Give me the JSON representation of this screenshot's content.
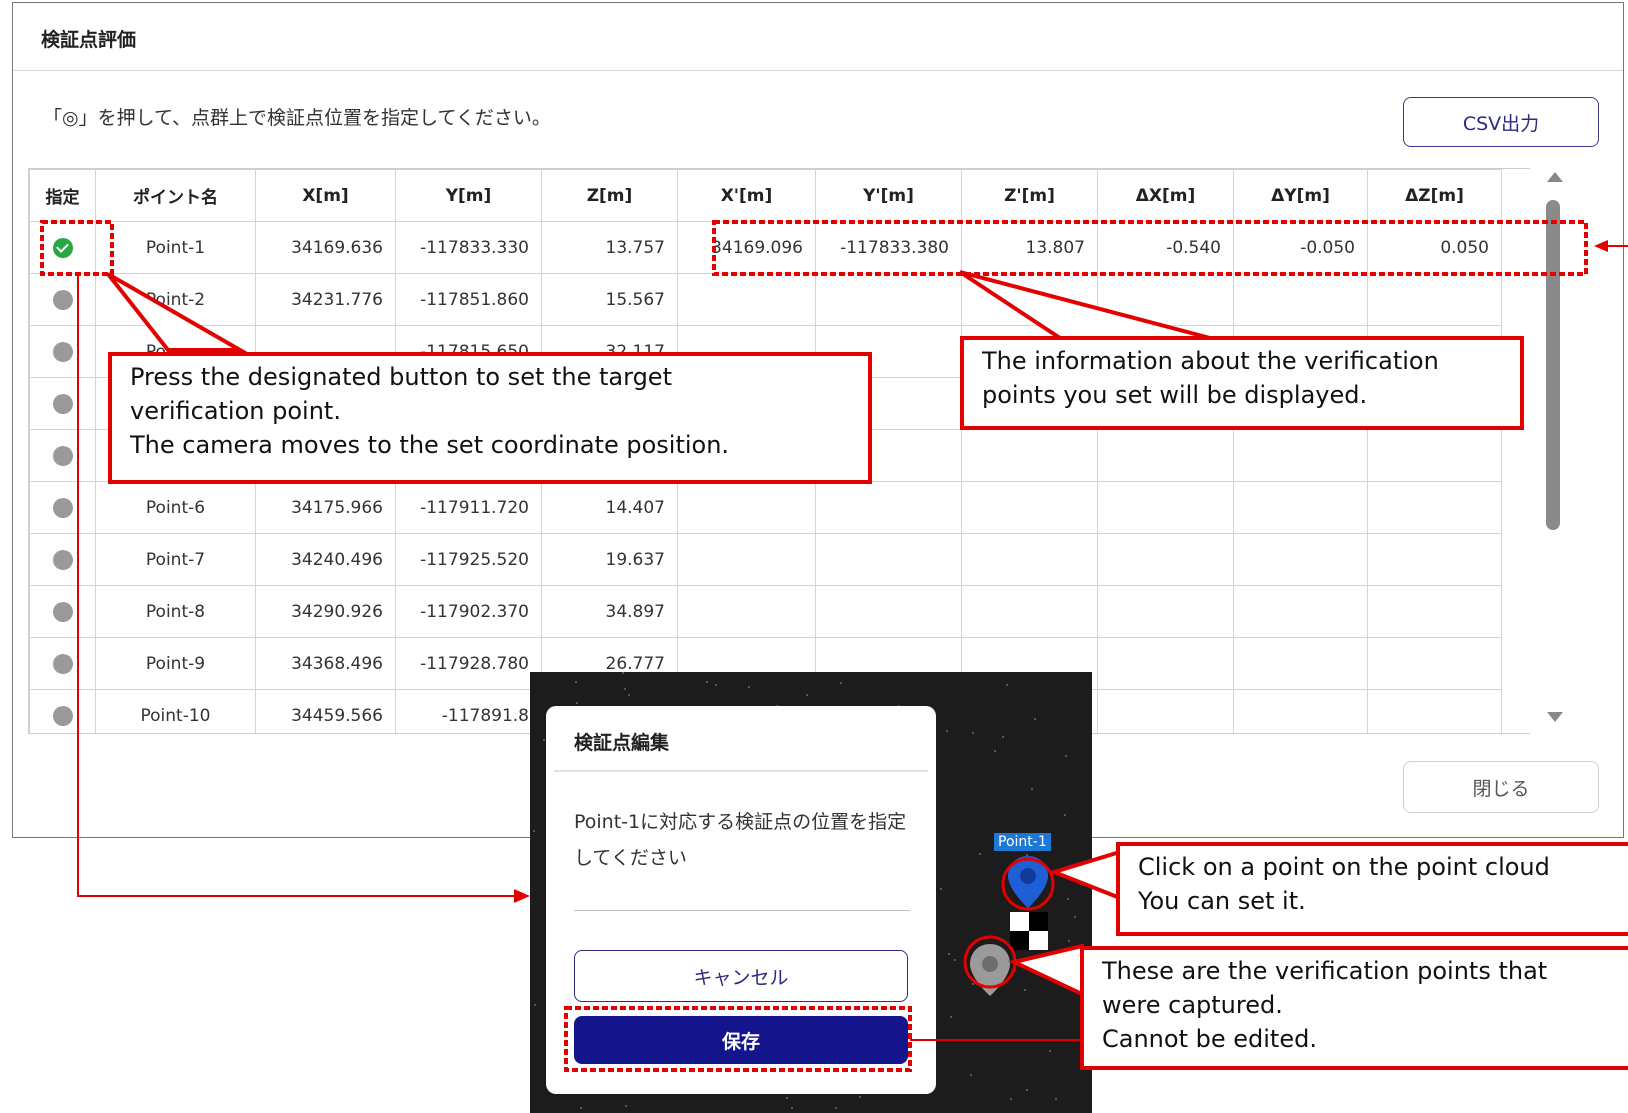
{
  "dialog": {
    "title": "検証点評価",
    "instruction": "「◎」を押して、点群上で検証点位置を指定してください。",
    "csv_button": "CSV出力",
    "close_button": "閉じる"
  },
  "table": {
    "headers": [
      "指定",
      "ポイント名",
      "X[m]",
      "Y[m]",
      "Z[m]",
      "X'[m]",
      "Y'[m]",
      "Z'[m]",
      "ΔX[m]",
      "ΔY[m]",
      "ΔZ[m]"
    ],
    "rows": [
      {
        "status": "set",
        "name": "Point-1",
        "x": "34169.636",
        "y": "-117833.330",
        "z": "13.757",
        "xp": "34169.096",
        "yp": "-117833.380",
        "zp": "13.807",
        "dx": "-0.540",
        "dy": "-0.050",
        "dz": "0.050"
      },
      {
        "status": "unset",
        "name": "Point-2",
        "x": "34231.776",
        "y": "-117851.860",
        "z": "15.567",
        "xp": "",
        "yp": "",
        "zp": "",
        "dx": "",
        "dy": "",
        "dz": ""
      },
      {
        "status": "unset",
        "name": "Point-3",
        "x": "",
        "y": "-117815.650",
        "z": "32.117",
        "xp": "",
        "yp": "",
        "zp": "",
        "dx": "",
        "dy": "",
        "dz": ""
      },
      {
        "status": "unset",
        "name": "",
        "x": "",
        "y": "",
        "z": "",
        "xp": "",
        "yp": "",
        "zp": "",
        "dx": "",
        "dy": "",
        "dz": ""
      },
      {
        "status": "unset",
        "name": "",
        "x": "",
        "y": "",
        "z": "",
        "xp": "",
        "yp": "",
        "zp": "",
        "dx": "",
        "dy": "",
        "dz": ""
      },
      {
        "status": "unset",
        "name": "Point-6",
        "x": "34175.966",
        "y": "-117911.720",
        "z": "14.407",
        "xp": "",
        "yp": "",
        "zp": "",
        "dx": "",
        "dy": "",
        "dz": ""
      },
      {
        "status": "unset",
        "name": "Point-7",
        "x": "34240.496",
        "y": "-117925.520",
        "z": "19.637",
        "xp": "",
        "yp": "",
        "zp": "",
        "dx": "",
        "dy": "",
        "dz": ""
      },
      {
        "status": "unset",
        "name": "Point-8",
        "x": "34290.926",
        "y": "-117902.370",
        "z": "34.897",
        "xp": "",
        "yp": "",
        "zp": "",
        "dx": "",
        "dy": "",
        "dz": ""
      },
      {
        "status": "unset",
        "name": "Point-9",
        "x": "34368.496",
        "y": "-117928.780",
        "z": "26.777",
        "xp": "",
        "yp": "",
        "zp": "",
        "dx": "",
        "dy": "",
        "dz": ""
      },
      {
        "status": "unset",
        "name": "Point-10",
        "x": "34459.566",
        "y": "-117891.8",
        "z": "",
        "xp": "",
        "yp": "",
        "zp": "",
        "dx": "",
        "dy": "",
        "dz": ""
      }
    ]
  },
  "edit_panel": {
    "title": "検証点編集",
    "message": "Point-1に対応する検証点の位置を指定してください",
    "cancel_button": "キャンセル",
    "save_button": "保存"
  },
  "viewer": {
    "point_label": "Point-1"
  },
  "callouts": {
    "designate": [
      "Press the designated button to set the target",
      "verification point.",
      "The camera moves to the set coordinate position."
    ],
    "info": [
      "The information about the verification",
      "points you set will be displayed."
    ],
    "click_point": [
      "Click on a point on the point cloud",
      "You can set it."
    ],
    "captured": [
      "These are the verification points that",
      "were captured.",
      "Cannot be edited."
    ]
  },
  "colors": {
    "annotation": "#e30000",
    "primary": "#14148c",
    "set_status": "#28a745",
    "unset_status": "#9a9a9a",
    "pin_blue": "#1f5fd6"
  }
}
